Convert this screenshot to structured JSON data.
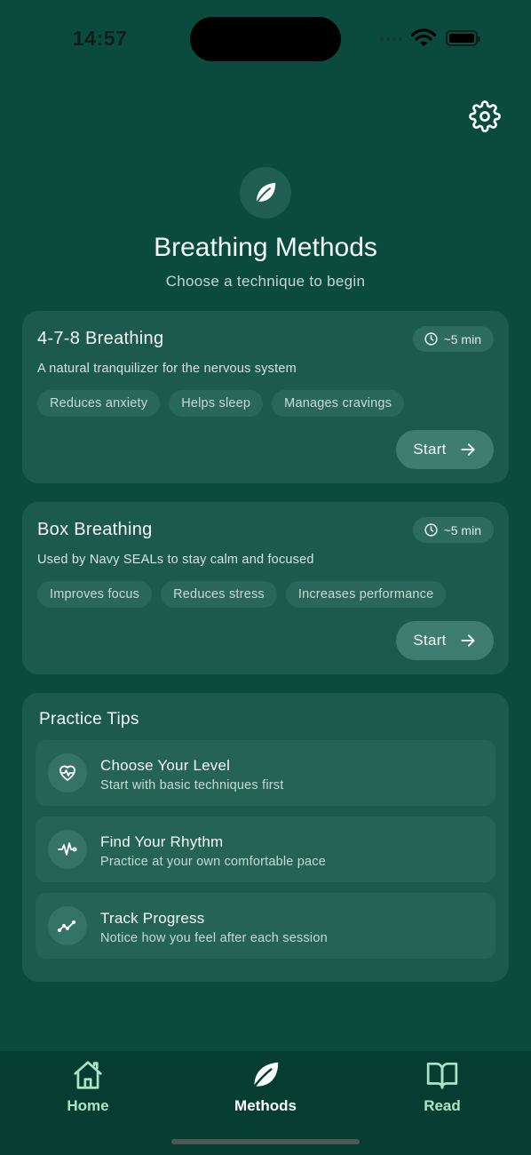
{
  "status_bar": {
    "time": "14:57"
  },
  "header": {
    "title": "Breathing Methods",
    "subtitle": "Choose a technique to begin"
  },
  "methods": [
    {
      "title": "4-7-8 Breathing",
      "duration": "~5 min",
      "description": "A natural tranquilizer for the nervous system",
      "tags": [
        "Reduces anxiety",
        "Helps sleep",
        "Manages cravings"
      ],
      "start_label": "Start"
    },
    {
      "title": "Box Breathing",
      "duration": "~5 min",
      "description": "Used by Navy SEALs to stay calm and focused",
      "tags": [
        "Improves focus",
        "Reduces stress",
        "Increases performance"
      ],
      "start_label": "Start"
    }
  ],
  "tips": {
    "title": "Practice Tips",
    "items": [
      {
        "title": "Choose Your Level",
        "description": "Start with basic techniques first",
        "icon": "heart-pulse-icon"
      },
      {
        "title": "Find Your Rhythm",
        "description": "Practice at your own comfortable pace",
        "icon": "activity-icon"
      },
      {
        "title": "Track Progress",
        "description": "Notice how you feel after each session",
        "icon": "trending-up-icon"
      }
    ]
  },
  "tab_bar": {
    "items": [
      {
        "label": "Home",
        "icon": "home-icon",
        "active": false
      },
      {
        "label": "Methods",
        "icon": "leaf-icon",
        "active": true
      },
      {
        "label": "Read",
        "icon": "book-icon",
        "active": false
      }
    ]
  },
  "colors": {
    "background": "#0b4b3e",
    "card": "#1d5a4e",
    "tab_bar": "#053d31",
    "tab_inactive": "#a9e5c6",
    "tab_active": "#ffffff"
  }
}
